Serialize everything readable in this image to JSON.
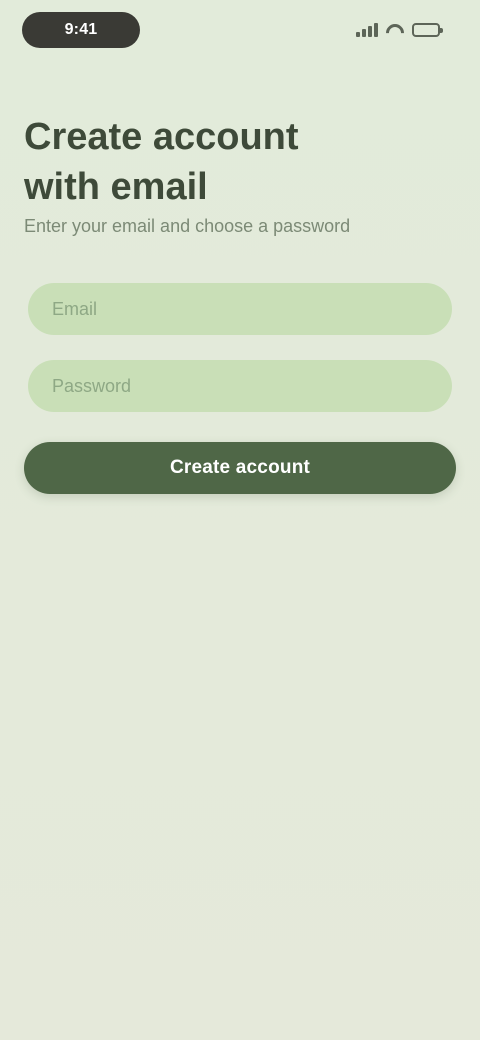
{
  "status_bar": {
    "time": "9:41",
    "icons": [
      "cellular-signal-icon",
      "wifi-icon",
      "battery-icon"
    ],
    "pill_color": "#3a3a35"
  },
  "screen": {
    "title": "Create account with email",
    "subtitle": "Enter your email and choose a password"
  },
  "form": {
    "email": {
      "value": "",
      "placeholder": "Email"
    },
    "password": {
      "value": "",
      "placeholder": "Password"
    },
    "submit_label": "Create account"
  },
  "colors": {
    "background": "#e4ebdb",
    "field": "#c9dfb7",
    "primary_button": "#4f6747",
    "title_text": "#3e4a39",
    "secondary_text": "#7c8a76"
  }
}
